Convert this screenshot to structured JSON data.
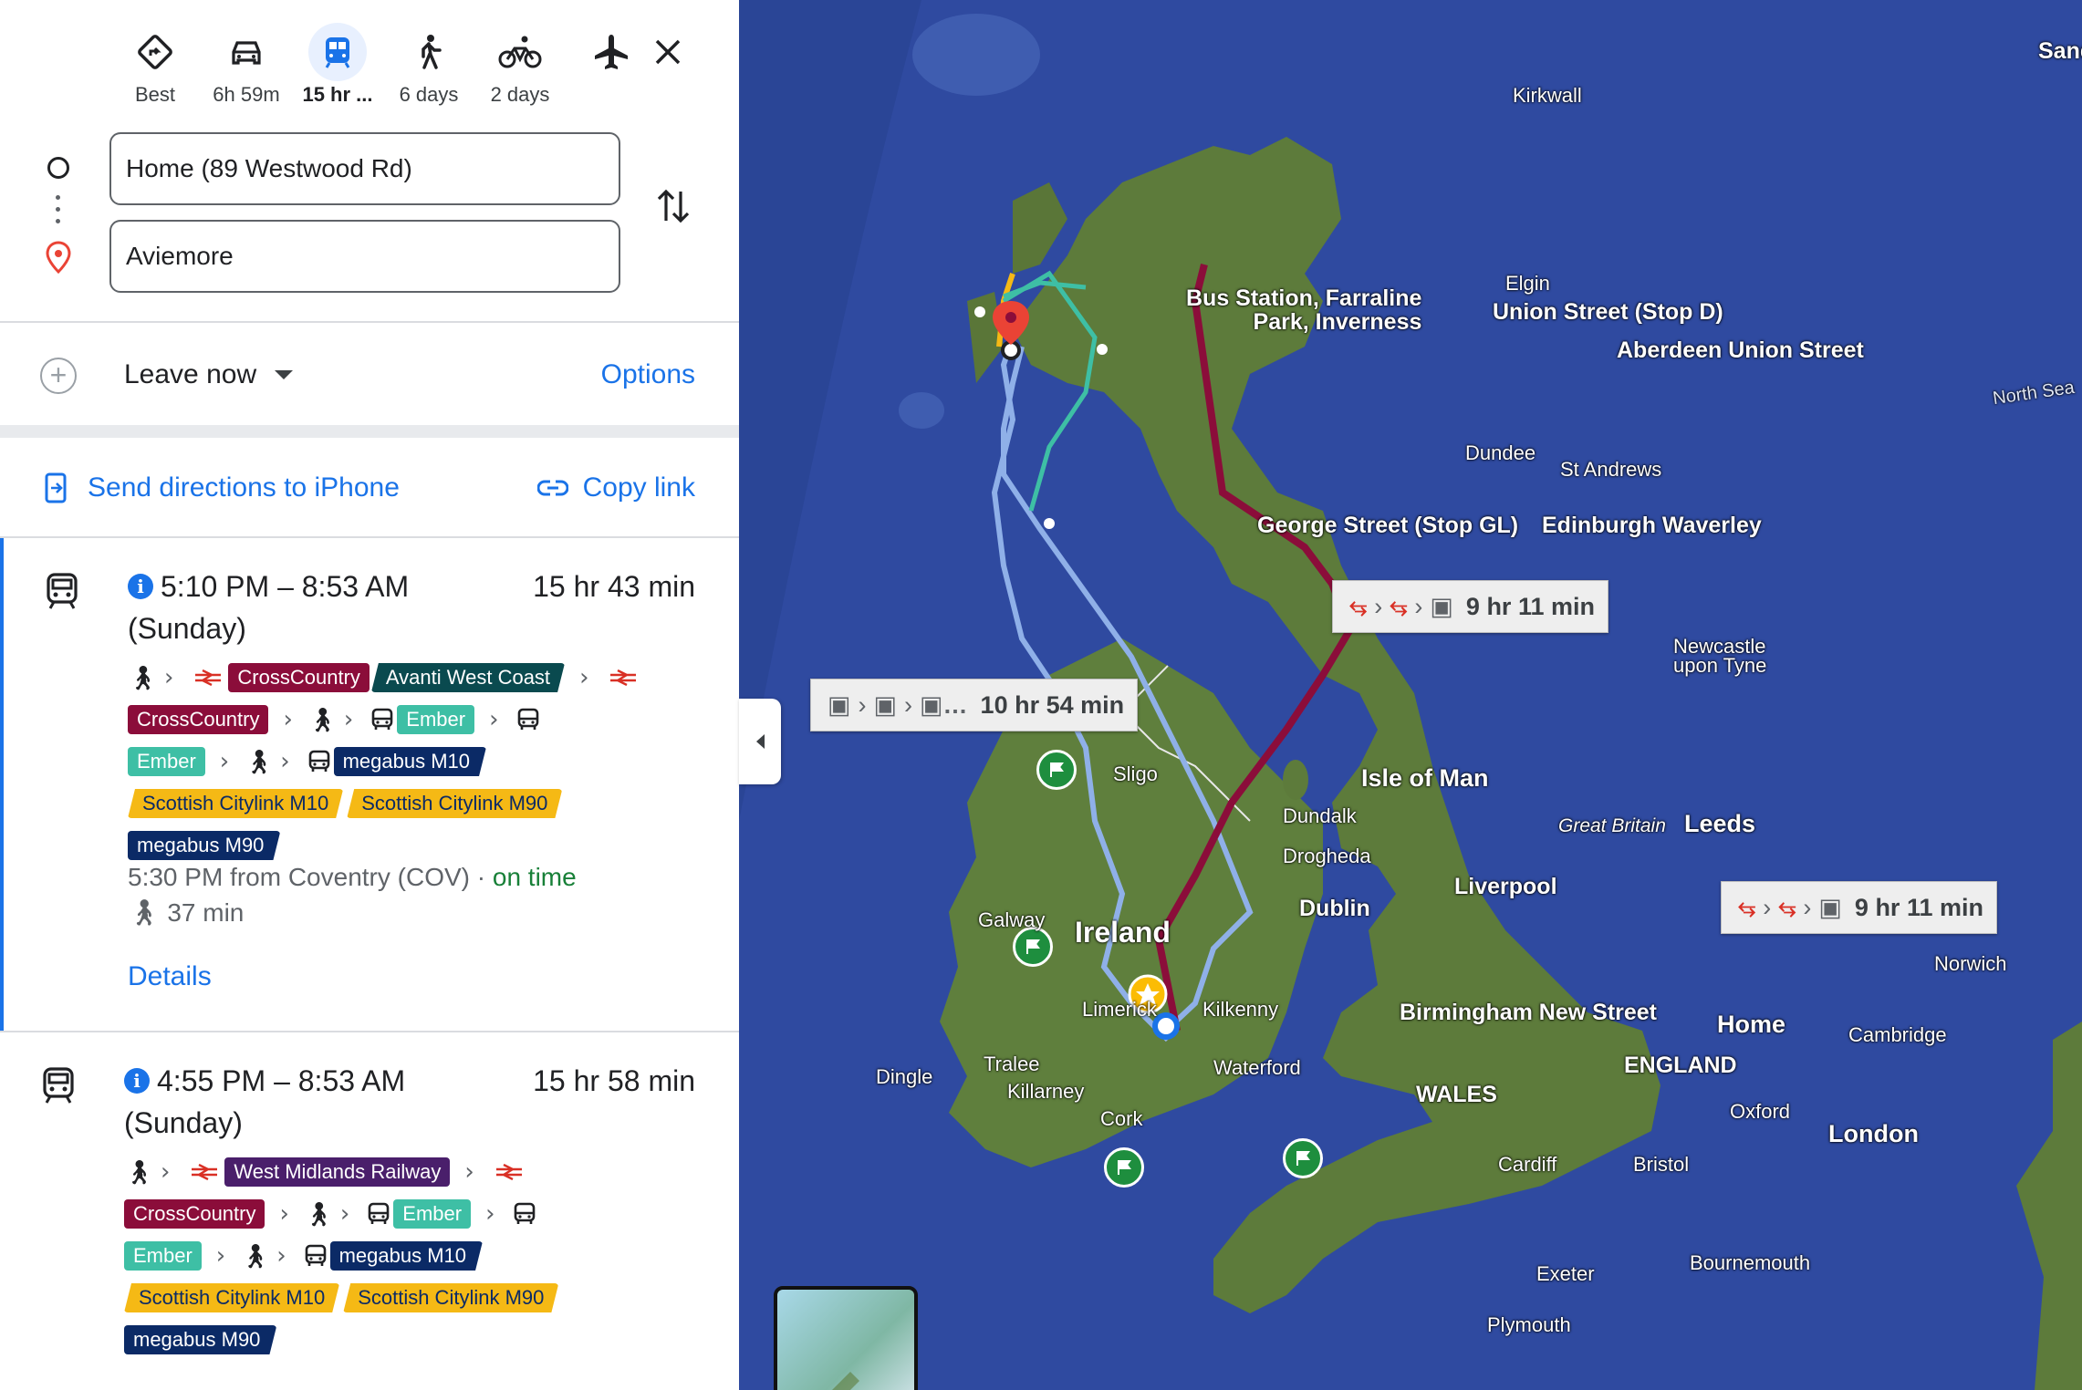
{
  "modes": [
    {
      "id": "best",
      "label": "Best",
      "icon": "directions-diamond-icon"
    },
    {
      "id": "drive",
      "label": "6h 59m",
      "icon": "car-icon"
    },
    {
      "id": "transit",
      "label": "15 hr ...",
      "icon": "train-icon",
      "active": true
    },
    {
      "id": "walk",
      "label": "6 days",
      "icon": "walk-icon"
    },
    {
      "id": "cycle",
      "label": "2 days",
      "icon": "bicycle-icon"
    },
    {
      "id": "flight",
      "label": "",
      "icon": "airplane-icon"
    }
  ],
  "inputs": {
    "origin": "Home (89 Westwood Rd)",
    "destination": "Aviemore"
  },
  "leave": {
    "label": "Leave now",
    "options": "Options"
  },
  "share": {
    "send": "Send directions to iPhone",
    "copy": "Copy link"
  },
  "routes": [
    {
      "times": "5:10 PM – 8:53 AM (Sunday)",
      "duration": "15 hr 43 min",
      "lines": {
        "crosscountry": "CrossCountry",
        "avanti": "Avanti West Coast",
        "ember": "Ember",
        "megabus_m10": "megabus M10",
        "citylink_m10": "Scottish Citylink M10",
        "citylink_m90": "Scottish Citylink M90",
        "megabus_m90": "megabus M90"
      },
      "departure": "5:30 PM from Coventry (COV) · ",
      "status": "on time",
      "walk": "37 min",
      "details": "Details"
    },
    {
      "times": "4:55 PM – 8:53 AM (Sunday)",
      "duration": "15 hr 58 min",
      "lines": {
        "wmr": "West Midlands Railway",
        "crosscountry": "CrossCountry",
        "ember": "Ember",
        "megabus_m10": "megabus M10",
        "citylink_m10": "Scottish Citylink M10",
        "citylink_m90": "Scottish Citylink M90",
        "megabus_m90": "megabus M90"
      }
    }
  ],
  "map": {
    "callouts": [
      "9 hr 11 min",
      "10 hr 54 min",
      "9 hr 11 min"
    ],
    "labels": {
      "sand": "Sand",
      "kirkwall": "Kirkwall",
      "elgin": "Elgin",
      "bus_station": "Bus Station, Farraline\nPark, Inverness",
      "union_street": "Union Street (Stop D)",
      "aberdeen": "Aberdeen Union Street",
      "north_sea": "North Sea",
      "dundee": "Dundee",
      "st_andrews": "St Andrews",
      "george_street": "George Street (Stop GL)",
      "edinburgh": "Edinburgh Waverley",
      "newcastle": "Newcastle\nupon Tyne",
      "sligo": "Sligo",
      "isle_of_man": "Isle of Man",
      "dundalk": "Dundalk",
      "great_britain": "Great Britain",
      "leeds": "Leeds",
      "drogheda": "Drogheda",
      "liverpool": "Liverpool",
      "galway": "Galway",
      "ireland": "Ireland",
      "dublin": "Dublin",
      "norwich": "Norwich",
      "limerick": "Limerick",
      "kilkenny": "Kilkenny",
      "birmingham": "Birmingham New Street",
      "home": "Home",
      "cambridge": "Cambridge",
      "tralee": "Tralee",
      "dingle": "Dingle",
      "killarney": "Killarney",
      "waterford": "Waterford",
      "england": "ENGLAND",
      "wales": "WALES",
      "cork": "Cork",
      "oxford": "Oxford",
      "london": "London",
      "cardiff": "Cardiff",
      "bristol": "Bristol",
      "exeter": "Exeter",
      "bournemouth": "Bournemouth",
      "plymouth": "Plymouth"
    },
    "colors": {
      "water": "#2f4aa0",
      "land": "#5b7a3a",
      "rail_route": "#8b0d3a",
      "bus_route": "#8fb0e8",
      "ember_route": "#3ebfa5",
      "citylink_route": "#f5b915"
    }
  }
}
